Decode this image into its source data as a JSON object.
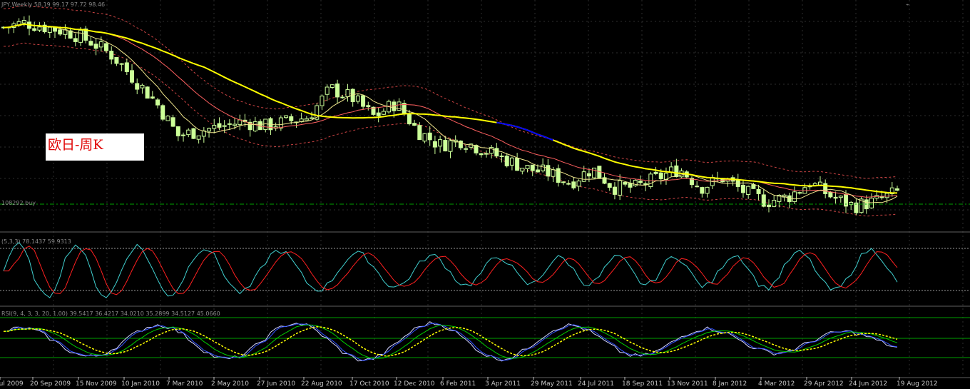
{
  "colors": {
    "background": "#000000",
    "grid": "#2e2e2e",
    "candle": "#ccff99",
    "ma_slow": "#ffff00",
    "ma_blue": "#0000ff",
    "ma_fast": "#f0e68c",
    "ma_red": "#ff6060",
    "envelope": "#cc4444",
    "stoch_main": "#40d0d0",
    "stoch_signal": "#ff2020",
    "rsi_line": "#d0d0ff",
    "rsi_blue": "#3050ff",
    "rsi_green": "#00cc00",
    "rsi_yellow": "#ffff00",
    "level_line": "#00a000"
  },
  "main_panel": {
    "header": "JPY,Weekly  58.19 99.17 97.72 98.46",
    "price_tag": "108292.buy",
    "chinese_label": "欧日-周K"
  },
  "stoch_panel": {
    "header": "(5,3,3) 78.1437 59.9313"
  },
  "rsi_panel": {
    "header": "RSI(9, 4, 3, 3, 20, 1.00) 39.5417 36.4217 34.0210 35.2899 34.5127 45.0660"
  },
  "x_axis": {
    "labels": [
      "Jul 2009",
      "20 Sep 2009",
      "15 Nov 2009",
      "10 Jan 2010",
      "7 Mar 2010",
      "2 May 2010",
      "27 Jun 2010",
      "22 Aug 2010",
      "17 Oct 2010",
      "12 Dec 2010",
      "6 Feb 2011",
      "3 Apr 2011",
      "29 May 2011",
      "24 Jul 2011",
      "18 Sep 2011",
      "13 Nov 2011",
      "8 Jan 2012",
      "4 Mar 2012",
      "29 Apr 2012",
      "24 Jun 2012",
      "19 Aug 2012"
    ]
  },
  "chart_data": {
    "type": "candlestick",
    "title": "欧日-周K",
    "weeks": [
      "Jul 2009",
      "20 Sep 2009",
      "15 Nov 2009",
      "10 Jan 2010",
      "7 Mar 2010",
      "2 May 2010",
      "27 Jun 2010",
      "22 Aug 2010",
      "17 Oct 2010",
      "12 Dec 2010",
      "6 Feb 2011",
      "3 Apr 2011",
      "29 May 2011",
      "24 Jul 2011",
      "18 Sep 2011",
      "13 Nov 2011",
      "8 Jan 2012",
      "4 Mar 2012",
      "29 Apr 2012",
      "24 Jun 2012",
      "19 Aug 2012"
    ],
    "close_path": [
      134,
      135,
      134,
      133,
      131,
      128,
      123,
      118,
      111,
      112,
      113,
      114,
      113,
      114,
      115,
      121,
      119,
      115,
      118,
      112,
      109,
      110,
      108,
      106,
      104,
      103,
      101,
      104,
      100,
      100,
      102,
      104,
      100,
      102,
      99,
      97,
      98,
      101,
      98,
      96,
      97,
      99
    ],
    "ma_slow": [
      135,
      134,
      132,
      130,
      128,
      125,
      121,
      118,
      115,
      113,
      112,
      113,
      114,
      114,
      114,
      114,
      113,
      112,
      111,
      110,
      108
    ],
    "subpanels": [
      "Stochastic",
      "RSI"
    ]
  }
}
